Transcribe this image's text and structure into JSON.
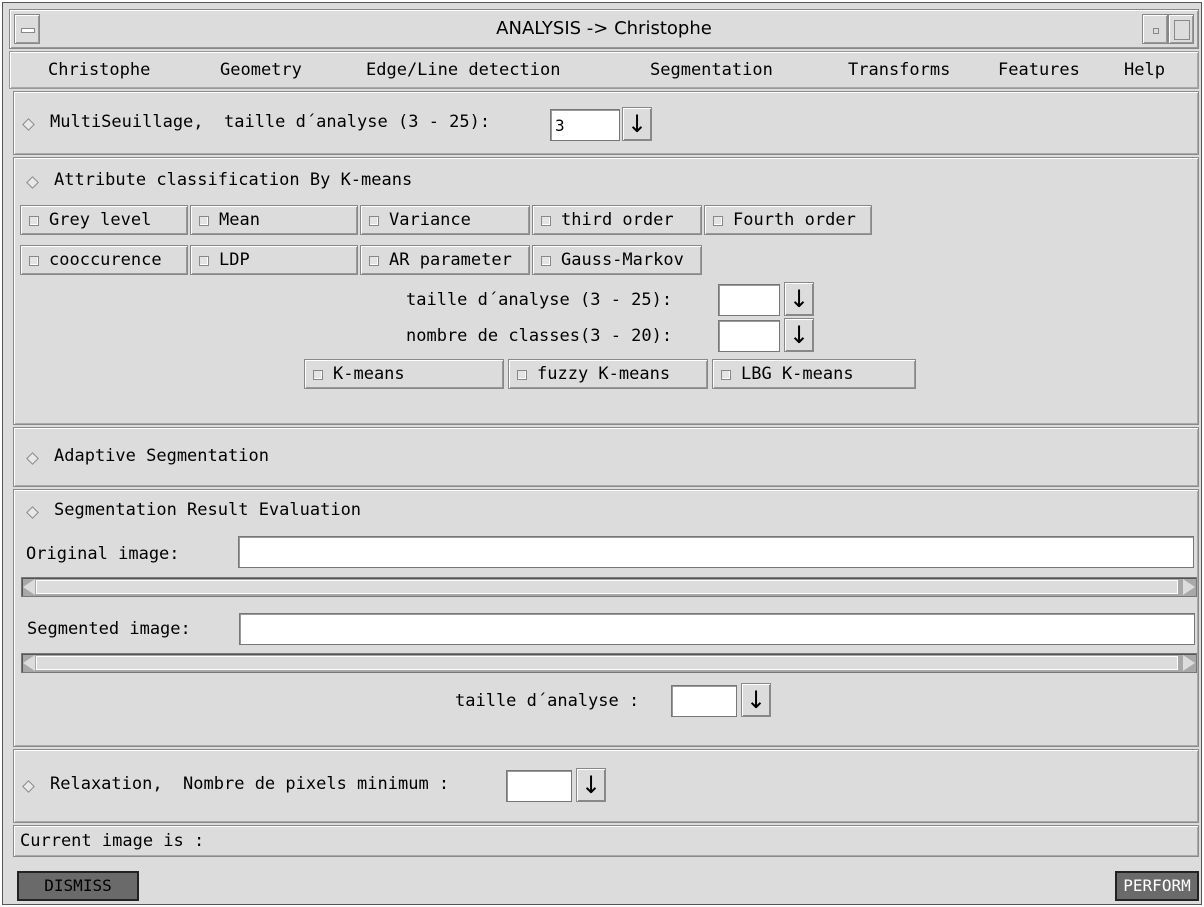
{
  "window": {
    "title": "ANALYSIS -> Christophe"
  },
  "menu": [
    "Christophe",
    "Geometry",
    "Edge/Line detection",
    "Segmentation",
    "Transforms",
    "Features",
    "Help"
  ],
  "multiseuil": {
    "label": "MultiSeuillage,  taille d´analyse (3 - 25):",
    "value": "3"
  },
  "kmeans": {
    "header": "Attribute classification By K-means",
    "row1": [
      "Grey level",
      "Mean",
      "Variance",
      "third order",
      "Fourth order"
    ],
    "row2": [
      "cooccurence",
      "LDP",
      "AR parameter",
      "Gauss-Markov"
    ],
    "taille_label": "taille d´analyse (3 - 25):",
    "taille_value": "",
    "classes_label": "nombre de classes(3 - 20):",
    "classes_value": "",
    "methods": [
      "K-means",
      "fuzzy K-means",
      "LBG K-means"
    ]
  },
  "adaptive": {
    "header": "Adaptive Segmentation"
  },
  "evaluation": {
    "header": "Segmentation Result Evaluation",
    "original_label": "Original image:",
    "original_value": "",
    "segmented_label": "Segmented image:",
    "segmented_value": "",
    "taille_label": "taille d´analyse :",
    "taille_value": ""
  },
  "relaxation": {
    "label": "Relaxation,  Nombre de pixels minimum :",
    "value": ""
  },
  "status": {
    "text": "Current image is :"
  },
  "buttons": {
    "dismiss": "DISMISS",
    "perform": "PERFORM"
  },
  "arrow_glyph": "↓"
}
